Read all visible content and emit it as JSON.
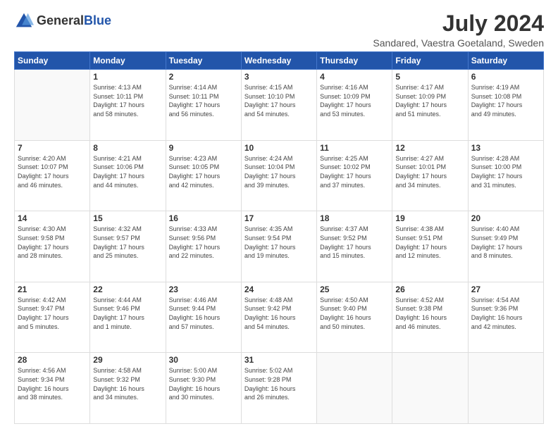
{
  "header": {
    "logo_general": "General",
    "logo_blue": "Blue",
    "title": "July 2024",
    "subtitle": "Sandared, Vaestra Goetaland, Sweden"
  },
  "columns": [
    "Sunday",
    "Monday",
    "Tuesday",
    "Wednesday",
    "Thursday",
    "Friday",
    "Saturday"
  ],
  "weeks": [
    [
      {
        "day": "",
        "info": ""
      },
      {
        "day": "1",
        "info": "Sunrise: 4:13 AM\nSunset: 10:11 PM\nDaylight: 17 hours\nand 58 minutes."
      },
      {
        "day": "2",
        "info": "Sunrise: 4:14 AM\nSunset: 10:11 PM\nDaylight: 17 hours\nand 56 minutes."
      },
      {
        "day": "3",
        "info": "Sunrise: 4:15 AM\nSunset: 10:10 PM\nDaylight: 17 hours\nand 54 minutes."
      },
      {
        "day": "4",
        "info": "Sunrise: 4:16 AM\nSunset: 10:09 PM\nDaylight: 17 hours\nand 53 minutes."
      },
      {
        "day": "5",
        "info": "Sunrise: 4:17 AM\nSunset: 10:09 PM\nDaylight: 17 hours\nand 51 minutes."
      },
      {
        "day": "6",
        "info": "Sunrise: 4:19 AM\nSunset: 10:08 PM\nDaylight: 17 hours\nand 49 minutes."
      }
    ],
    [
      {
        "day": "7",
        "info": "Sunrise: 4:20 AM\nSunset: 10:07 PM\nDaylight: 17 hours\nand 46 minutes."
      },
      {
        "day": "8",
        "info": "Sunrise: 4:21 AM\nSunset: 10:06 PM\nDaylight: 17 hours\nand 44 minutes."
      },
      {
        "day": "9",
        "info": "Sunrise: 4:23 AM\nSunset: 10:05 PM\nDaylight: 17 hours\nand 42 minutes."
      },
      {
        "day": "10",
        "info": "Sunrise: 4:24 AM\nSunset: 10:04 PM\nDaylight: 17 hours\nand 39 minutes."
      },
      {
        "day": "11",
        "info": "Sunrise: 4:25 AM\nSunset: 10:02 PM\nDaylight: 17 hours\nand 37 minutes."
      },
      {
        "day": "12",
        "info": "Sunrise: 4:27 AM\nSunset: 10:01 PM\nDaylight: 17 hours\nand 34 minutes."
      },
      {
        "day": "13",
        "info": "Sunrise: 4:28 AM\nSunset: 10:00 PM\nDaylight: 17 hours\nand 31 minutes."
      }
    ],
    [
      {
        "day": "14",
        "info": "Sunrise: 4:30 AM\nSunset: 9:58 PM\nDaylight: 17 hours\nand 28 minutes."
      },
      {
        "day": "15",
        "info": "Sunrise: 4:32 AM\nSunset: 9:57 PM\nDaylight: 17 hours\nand 25 minutes."
      },
      {
        "day": "16",
        "info": "Sunrise: 4:33 AM\nSunset: 9:56 PM\nDaylight: 17 hours\nand 22 minutes."
      },
      {
        "day": "17",
        "info": "Sunrise: 4:35 AM\nSunset: 9:54 PM\nDaylight: 17 hours\nand 19 minutes."
      },
      {
        "day": "18",
        "info": "Sunrise: 4:37 AM\nSunset: 9:52 PM\nDaylight: 17 hours\nand 15 minutes."
      },
      {
        "day": "19",
        "info": "Sunrise: 4:38 AM\nSunset: 9:51 PM\nDaylight: 17 hours\nand 12 minutes."
      },
      {
        "day": "20",
        "info": "Sunrise: 4:40 AM\nSunset: 9:49 PM\nDaylight: 17 hours\nand 8 minutes."
      }
    ],
    [
      {
        "day": "21",
        "info": "Sunrise: 4:42 AM\nSunset: 9:47 PM\nDaylight: 17 hours\nand 5 minutes."
      },
      {
        "day": "22",
        "info": "Sunrise: 4:44 AM\nSunset: 9:46 PM\nDaylight: 17 hours\nand 1 minute."
      },
      {
        "day": "23",
        "info": "Sunrise: 4:46 AM\nSunset: 9:44 PM\nDaylight: 16 hours\nand 57 minutes."
      },
      {
        "day": "24",
        "info": "Sunrise: 4:48 AM\nSunset: 9:42 PM\nDaylight: 16 hours\nand 54 minutes."
      },
      {
        "day": "25",
        "info": "Sunrise: 4:50 AM\nSunset: 9:40 PM\nDaylight: 16 hours\nand 50 minutes."
      },
      {
        "day": "26",
        "info": "Sunrise: 4:52 AM\nSunset: 9:38 PM\nDaylight: 16 hours\nand 46 minutes."
      },
      {
        "day": "27",
        "info": "Sunrise: 4:54 AM\nSunset: 9:36 PM\nDaylight: 16 hours\nand 42 minutes."
      }
    ],
    [
      {
        "day": "28",
        "info": "Sunrise: 4:56 AM\nSunset: 9:34 PM\nDaylight: 16 hours\nand 38 minutes."
      },
      {
        "day": "29",
        "info": "Sunrise: 4:58 AM\nSunset: 9:32 PM\nDaylight: 16 hours\nand 34 minutes."
      },
      {
        "day": "30",
        "info": "Sunrise: 5:00 AM\nSunset: 9:30 PM\nDaylight: 16 hours\nand 30 minutes."
      },
      {
        "day": "31",
        "info": "Sunrise: 5:02 AM\nSunset: 9:28 PM\nDaylight: 16 hours\nand 26 minutes."
      },
      {
        "day": "",
        "info": ""
      },
      {
        "day": "",
        "info": ""
      },
      {
        "day": "",
        "info": ""
      }
    ]
  ]
}
